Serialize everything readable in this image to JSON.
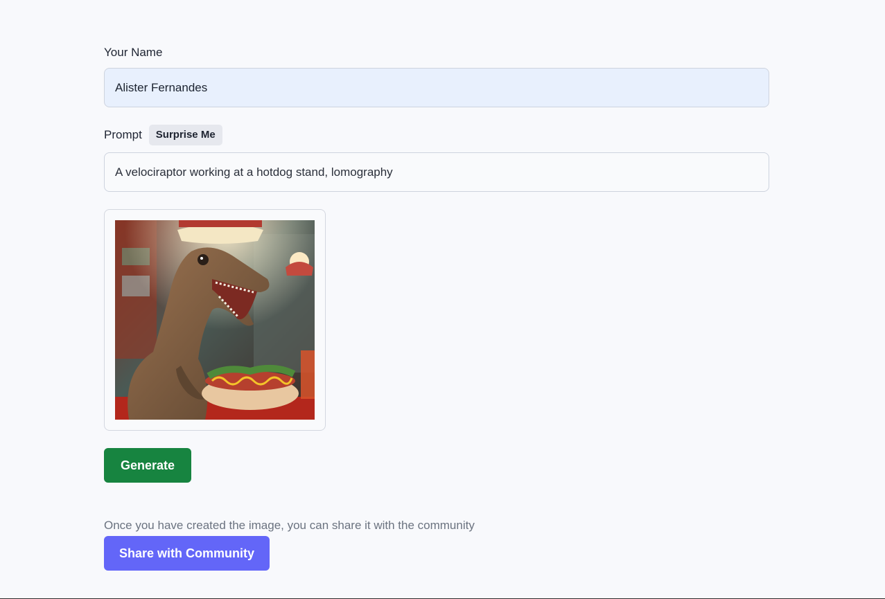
{
  "form": {
    "name_label": "Your Name",
    "name_value": "Alister Fernandes",
    "prompt_label": "Prompt",
    "surprise_label": "Surprise Me",
    "prompt_value": "A velociraptor working at a hotdog stand, lomography"
  },
  "actions": {
    "generate_label": "Generate",
    "share_note": "Once you have created the image, you can share it with the community",
    "share_label": "Share with Community"
  },
  "colors": {
    "generate_bg": "#178440",
    "share_bg": "#6366f8",
    "name_input_bg": "#e8f0fd"
  }
}
